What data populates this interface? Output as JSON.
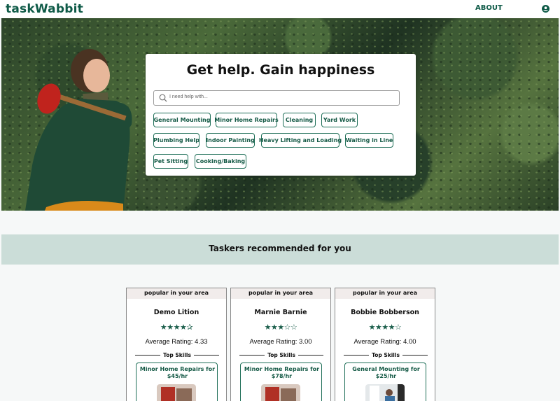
{
  "header": {
    "logo": "taskWabbit",
    "about_label": "ABOUT",
    "user_icon": "user-circle-icon"
  },
  "hero": {
    "title": "Get help. Gain happiness",
    "search": {
      "placeholder": "I need help with...",
      "icon": "search-icon"
    },
    "categories": [
      "General Mounting",
      "Minor Home Repairs",
      "Cleaning",
      "Yard Work",
      "Plumbing Help",
      "Indoor Painting",
      "Heavy Lifting and Loading",
      "Waiting in Line",
      "Pet Sitting",
      "Cooking/Baking"
    ]
  },
  "recommended": {
    "title": "Taskers recommended for you",
    "cards": [
      {
        "badge": "popular in your area",
        "name": "Demo Lition",
        "stars": "★★★★✰",
        "rating": 4.33,
        "rating_label": "Average Rating: 4.33",
        "skills_label": "Top Skills",
        "skill": "Minor Home Repairs for $45/hr"
      },
      {
        "badge": "popular in your area",
        "name": "Marnie Barnie",
        "stars": "★★★☆☆",
        "rating": 3.0,
        "rating_label": "Average Rating: 3.00",
        "skills_label": "Top Skills",
        "skill": "Minor Home Repairs for $78/hr"
      },
      {
        "badge": "popular in your area",
        "name": "Bobbie Bobberson",
        "stars": "★★★★☆",
        "rating": 4.0,
        "rating_label": "Average Rating: 4.00",
        "skills_label": "Top Skills",
        "skill": "General Mounting for $25/hr"
      }
    ]
  },
  "colors": {
    "brand": "#0e5a47",
    "chip_border": "#1f6f58",
    "band": "#cbddd8"
  }
}
